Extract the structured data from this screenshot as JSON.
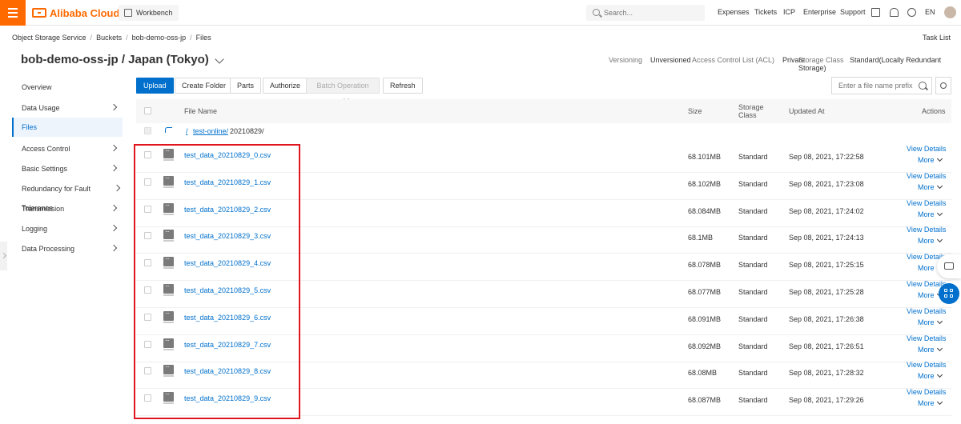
{
  "topbar": {
    "brand": "Alibaba Cloud",
    "workbench": "Workbench",
    "search_placeholder": "Search...",
    "nav": [
      "Expenses",
      "Tickets",
      "ICP",
      "Enterprise",
      "Support"
    ],
    "lang": "EN",
    "accent_color": "#ff6a00"
  },
  "breadcrumb": [
    "Object Storage Service",
    "Buckets",
    "bob-demo-oss-jp",
    "Files"
  ],
  "task_list": "Task List",
  "title": "bob-demo-oss-jp / Japan (Tokyo)",
  "meta": {
    "versioning_label": "Versioning",
    "versioning_value": "Unversioned",
    "acl_label": "Access Control List (ACL)",
    "acl_value": "Private",
    "storage_label": "Storage Class",
    "storage_value": "Standard(Locally Redundant Storage)"
  },
  "sidebar": {
    "items": [
      {
        "label": "Overview",
        "chevron": false,
        "active": false
      },
      {
        "label": "Data Usage",
        "chevron": true,
        "active": false
      },
      {
        "label": "Files",
        "chevron": false,
        "active": true
      },
      {
        "label": "Access Control",
        "chevron": true,
        "active": false
      },
      {
        "label": "Basic Settings",
        "chevron": true,
        "active": false
      },
      {
        "label": "Redundancy for Fault Tolerance",
        "chevron": true,
        "active": false
      },
      {
        "label": "Transmission",
        "chevron": true,
        "active": false
      },
      {
        "label": "Logging",
        "chevron": true,
        "active": false
      },
      {
        "label": "Data Processing",
        "chevron": true,
        "active": false
      }
    ]
  },
  "toolbar": {
    "upload": "Upload",
    "create_folder": "Create Folder",
    "parts": "Parts",
    "authorize": "Authorize",
    "batch": "Batch Operation",
    "refresh": "Refresh",
    "file_search_placeholder": "Enter a file name prefix"
  },
  "table": {
    "headers": {
      "file_name": "File Name",
      "size": "Size",
      "storage_class": "Storage Class",
      "updated_at": "Updated At",
      "actions": "Actions"
    },
    "path": {
      "root": "/",
      "folder": "test-online/",
      "current": "20210829/"
    },
    "rows": [
      {
        "name": "test_data_20210829_0.csv",
        "size": "68.101MB",
        "class": "Standard",
        "updated": "Sep 08, 2021, 17:22:58"
      },
      {
        "name": "test_data_20210829_1.csv",
        "size": "68.102MB",
        "class": "Standard",
        "updated": "Sep 08, 2021, 17:23:08"
      },
      {
        "name": "test_data_20210829_2.csv",
        "size": "68.084MB",
        "class": "Standard",
        "updated": "Sep 08, 2021, 17:24:02"
      },
      {
        "name": "test_data_20210829_3.csv",
        "size": "68.1MB",
        "class": "Standard",
        "updated": "Sep 08, 2021, 17:24:13"
      },
      {
        "name": "test_data_20210829_4.csv",
        "size": "68.078MB",
        "class": "Standard",
        "updated": "Sep 08, 2021, 17:25:15"
      },
      {
        "name": "test_data_20210829_5.csv",
        "size": "68.077MB",
        "class": "Standard",
        "updated": "Sep 08, 2021, 17:25:28"
      },
      {
        "name": "test_data_20210829_6.csv",
        "size": "68.091MB",
        "class": "Standard",
        "updated": "Sep 08, 2021, 17:26:38"
      },
      {
        "name": "test_data_20210829_7.csv",
        "size": "68.092MB",
        "class": "Standard",
        "updated": "Sep 08, 2021, 17:26:51"
      },
      {
        "name": "test_data_20210829_8.csv",
        "size": "68.08MB",
        "class": "Standard",
        "updated": "Sep 08, 2021, 17:28:32"
      },
      {
        "name": "test_data_20210829_9.csv",
        "size": "68.087MB",
        "class": "Standard",
        "updated": "Sep 08, 2021, 17:29:26"
      }
    ],
    "view_details": "View Details",
    "more": "More"
  },
  "link_color": "#0070cc",
  "highlight_color": "#e0161f"
}
